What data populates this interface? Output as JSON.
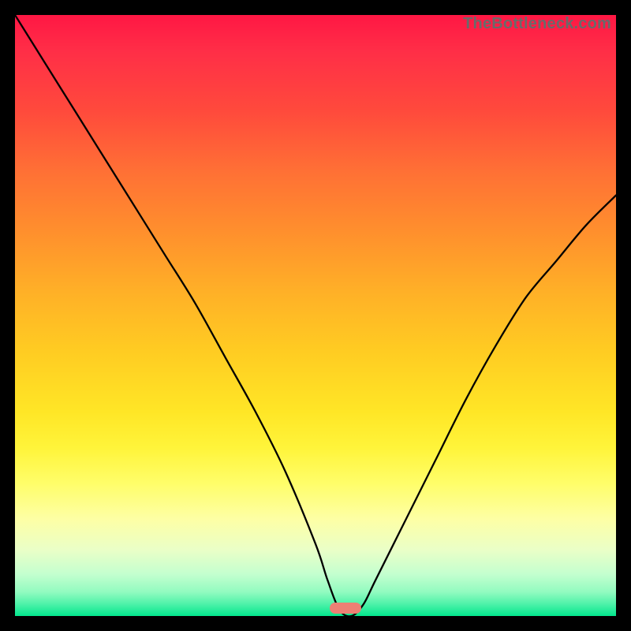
{
  "watermark": "TheBottleneck.com",
  "chart_data": {
    "type": "line",
    "title": "",
    "xlabel": "",
    "ylabel": "",
    "xlim": [
      0,
      100
    ],
    "ylim": [
      0,
      100
    ],
    "x": [
      0,
      5,
      10,
      15,
      20,
      25,
      30,
      35,
      40,
      45,
      50,
      52,
      54,
      56,
      58,
      60,
      65,
      70,
      75,
      80,
      85,
      90,
      95,
      100
    ],
    "values": [
      100,
      92,
      84,
      76,
      68,
      60,
      52,
      43,
      34,
      24,
      12,
      6,
      1,
      0,
      2,
      6,
      16,
      26,
      36,
      45,
      53,
      59,
      65,
      70
    ],
    "note": "V-shaped bottleneck curve on a red-to-green vertical gradient. The minimum (0%) lies near x≈55% with a small pill marker at the bottom; values are approximate readings from the plot shape since no axes or tick labels are shown."
  },
  "marker": {
    "x_pct": 55,
    "y_pct": 98.7,
    "color": "#ed8074"
  }
}
